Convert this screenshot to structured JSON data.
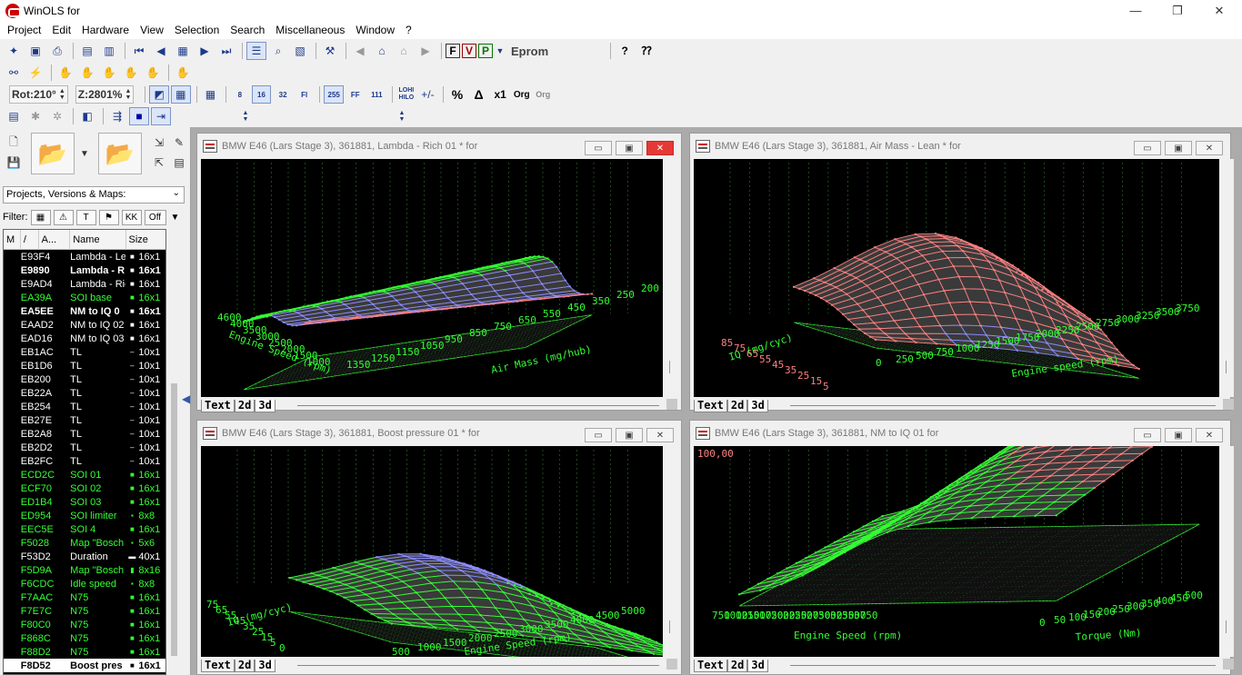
{
  "app": {
    "title": "WinOLS for"
  },
  "menu": [
    "Project",
    "Edit",
    "Hardware",
    "View",
    "Selection",
    "Search",
    "Miscellaneous",
    "Window",
    "?"
  ],
  "toolbar": {
    "eprom_label": "Eprom",
    "rotation": "Rot:210°",
    "zoom": "Z:2801%",
    "bit8": "8",
    "bit16": "16",
    "bit32": "32",
    "bitfl": "Fl",
    "hex255": "255",
    "hexff": "FF",
    "bin111": "111",
    "lohi": "LOHI",
    "hilo": "HILO",
    "pct": "%",
    "delta": "Δ",
    "x1": "x1",
    "org": "Org",
    "orgsm": "Org"
  },
  "left": {
    "dropdown": "Projects, Versions & Maps:",
    "filter_label": "Filter:",
    "filter_off": "Off",
    "columns": [
      "M",
      "/",
      "A...",
      "Name",
      "Size"
    ],
    "rows": [
      {
        "addr": "E93F4",
        "name": "Lambda - Le",
        "size": "16x1",
        "color": "#ffffff",
        "bold": false,
        "icon": "■"
      },
      {
        "addr": "E9890",
        "name": "Lambda - R",
        "size": "16x1",
        "color": "#ffffff",
        "bold": true,
        "icon": "■"
      },
      {
        "addr": "E9AD4",
        "name": "Lambda - Ric",
        "size": "16x1",
        "color": "#ffffff",
        "bold": false,
        "icon": "■"
      },
      {
        "addr": "EA39A",
        "name": "SOI base",
        "size": "16x1",
        "color": "#33ff33",
        "bold": false,
        "icon": "■"
      },
      {
        "addr": "EA5EE",
        "name": "NM to IQ 0",
        "size": "16x1",
        "color": "#ffffff",
        "bold": true,
        "icon": "■"
      },
      {
        "addr": "EAAD2",
        "name": "NM to IQ 02",
        "size": "16x1",
        "color": "#ffffff",
        "bold": false,
        "icon": "■"
      },
      {
        "addr": "EAD16",
        "name": "NM to IQ 03",
        "size": "16x1",
        "color": "#ffffff",
        "bold": false,
        "icon": "■"
      },
      {
        "addr": "EB1AC",
        "name": "TL",
        "size": "10x1",
        "color": "#ffffff",
        "bold": false,
        "icon": "–"
      },
      {
        "addr": "EB1D6",
        "name": "TL",
        "size": "10x1",
        "color": "#ffffff",
        "bold": false,
        "icon": "–"
      },
      {
        "addr": "EB200",
        "name": "TL",
        "size": "10x1",
        "color": "#ffffff",
        "bold": false,
        "icon": "–"
      },
      {
        "addr": "EB22A",
        "name": "TL",
        "size": "10x1",
        "color": "#ffffff",
        "bold": false,
        "icon": "–"
      },
      {
        "addr": "EB254",
        "name": "TL",
        "size": "10x1",
        "color": "#ffffff",
        "bold": false,
        "icon": "–"
      },
      {
        "addr": "EB27E",
        "name": "TL",
        "size": "10x1",
        "color": "#ffffff",
        "bold": false,
        "icon": "–"
      },
      {
        "addr": "EB2A8",
        "name": "TL",
        "size": "10x1",
        "color": "#ffffff",
        "bold": false,
        "icon": "–"
      },
      {
        "addr": "EB2D2",
        "name": "TL",
        "size": "10x1",
        "color": "#ffffff",
        "bold": false,
        "icon": "–"
      },
      {
        "addr": "EB2FC",
        "name": "TL",
        "size": "10x1",
        "color": "#ffffff",
        "bold": false,
        "icon": "–"
      },
      {
        "addr": "ECD2C",
        "name": "SOI 01",
        "size": "16x1",
        "color": "#33ff33",
        "bold": false,
        "icon": "■"
      },
      {
        "addr": "ECF70",
        "name": "SOI 02",
        "size": "16x1",
        "color": "#33ff33",
        "bold": false,
        "icon": "■"
      },
      {
        "addr": "ED1B4",
        "name": "SOI 03",
        "size": "16x1",
        "color": "#33ff33",
        "bold": false,
        "icon": "■"
      },
      {
        "addr": "ED954",
        "name": "SOI limiter",
        "size": "8x8",
        "color": "#33ff33",
        "bold": false,
        "icon": "▪"
      },
      {
        "addr": "EEC5E",
        "name": "SOI 4",
        "size": "16x1",
        "color": "#33ff33",
        "bold": false,
        "icon": "■"
      },
      {
        "addr": "F5028",
        "name": "Map \"Bosch",
        "size": "5x6",
        "color": "#33ff33",
        "bold": false,
        "icon": "▪"
      },
      {
        "addr": "F53D2",
        "name": "Duration",
        "size": "40x1",
        "color": "#ffffff",
        "bold": false,
        "icon": "▬"
      },
      {
        "addr": "F5D9A",
        "name": "Map \"Bosch",
        "size": "8x16",
        "color": "#33ff33",
        "bold": false,
        "icon": "▮"
      },
      {
        "addr": "F6CDC",
        "name": "Idle speed",
        "size": "8x8",
        "color": "#33ff33",
        "bold": false,
        "icon": "▪"
      },
      {
        "addr": "F7AAC",
        "name": "N75",
        "size": "16x1",
        "color": "#33ff33",
        "bold": false,
        "icon": "■"
      },
      {
        "addr": "F7E7C",
        "name": "N75",
        "size": "16x1",
        "color": "#33ff33",
        "bold": false,
        "icon": "■"
      },
      {
        "addr": "F80C0",
        "name": "N75",
        "size": "16x1",
        "color": "#33ff33",
        "bold": false,
        "icon": "■"
      },
      {
        "addr": "F868C",
        "name": "N75",
        "size": "16x1",
        "color": "#33ff33",
        "bold": false,
        "icon": "■"
      },
      {
        "addr": "F88D2",
        "name": "N75",
        "size": "16x1",
        "color": "#33ff33",
        "bold": false,
        "icon": "■"
      },
      {
        "addr": "F8D52",
        "name": "Boost pres",
        "size": "16x1",
        "color": "#000000",
        "bold": true,
        "icon": "■",
        "selected": true
      }
    ]
  },
  "windows": [
    {
      "title": "BMW E46 (Lars Stage 3), 361881, Lambda - Rich 01 * for",
      "axis_y_label": "Engine Speed (rpm)",
      "axis_x_label": "Air Mass (mg/hub)",
      "y_ticks": [
        "4600",
        "4000",
        "3500",
        "3000",
        "2500",
        "2000",
        "1500",
        "1000"
      ],
      "x_ticks": [
        "1350",
        "1250",
        "1150",
        "1050",
        "950",
        "850",
        "750",
        "650",
        "550",
        "450",
        "350",
        "250",
        "200"
      ],
      "tabs": [
        "Text",
        "2d",
        "3d"
      ]
    },
    {
      "title": "BMW E46 (Lars Stage 3), 361881, Air Mass - Lean * for",
      "axis_y_label": "IQ (mg/cyc)",
      "axis_x_label": "Engine speed (rpm)",
      "y_ticks": [
        "85",
        "75",
        "65",
        "55",
        "45",
        "35",
        "25",
        "15",
        "5"
      ],
      "x_ticks": [
        "0",
        "250",
        "500",
        "750",
        "1000",
        "1250",
        "1500",
        "1750",
        "2000",
        "2250",
        "2500",
        "2750",
        "3000",
        "3250",
        "3500",
        "3750"
      ],
      "tabs": [
        "Text",
        "2d",
        "3d"
      ]
    },
    {
      "title": "BMW E46 (Lars Stage 3), 361881, Boost pressure 01 * for",
      "axis_y_label": "IQ (mg/cyc)",
      "axis_x_label": "Engine Speed (rpm)",
      "y_ticks": [
        "75",
        "65",
        "55",
        "45",
        "35",
        "25",
        "15",
        "5",
        "0"
      ],
      "x_ticks": [
        "500",
        "1000",
        "1500",
        "2000",
        "2500",
        "3000",
        "3500",
        "4000",
        "4500",
        "5000"
      ],
      "tabs": [
        "Text",
        "2d",
        "3d"
      ]
    },
    {
      "title": "BMW E46 (Lars Stage 3), 361881, NM to IQ 01 for",
      "z_top": "100,00",
      "axis_y_label": "Engine Speed (rpm)",
      "axis_x_label": "Torque (Nm)",
      "y_ticks": [
        "750",
        "1000",
        "1250",
        "1500",
        "1750",
        "2000",
        "2250",
        "2500",
        "2750",
        "3000",
        "3250",
        "3500",
        "3750"
      ],
      "x_ticks": [
        "0",
        "50",
        "100",
        "150",
        "200",
        "250",
        "300",
        "350",
        "400",
        "450",
        "500"
      ],
      "tabs": [
        "Text",
        "2d",
        "3d"
      ]
    }
  ],
  "colors": {
    "green": "#33ff33",
    "pink": "#ff8080",
    "blue": "#8c8cff",
    "plot_bg": "#000000"
  }
}
